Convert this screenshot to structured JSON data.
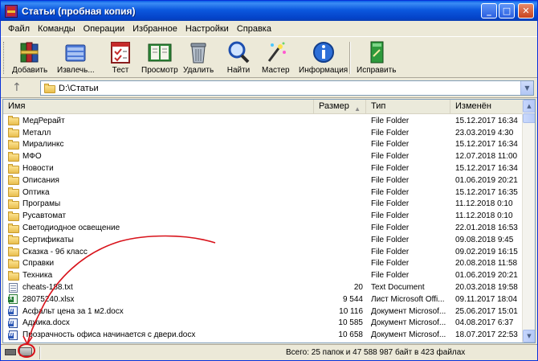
{
  "window": {
    "title": "Статьи (пробная копия)",
    "min_glyph": "_",
    "max_glyph": "□",
    "close_glyph": "✕"
  },
  "menu": [
    "Файл",
    "Команды",
    "Операции",
    "Избранное",
    "Настройки",
    "Справка"
  ],
  "toolbar": {
    "buttons": [
      {
        "label": "Добавить",
        "icon": "archive-books-icon"
      },
      {
        "label": "Извлечь...",
        "icon": "extract-folder-icon"
      },
      {
        "label": "Тест",
        "icon": "test-checklist-icon"
      },
      {
        "label": "Просмотр",
        "icon": "view-book-icon"
      },
      {
        "label": "Удалить",
        "icon": "trash-can-icon"
      },
      {
        "label": "Найти",
        "icon": "magnifier-icon"
      },
      {
        "label": "Мастер",
        "icon": "magic-wand-icon"
      },
      {
        "label": "Информация",
        "icon": "info-icon"
      },
      {
        "label": "Исправить",
        "icon": "repair-book-icon"
      }
    ]
  },
  "address": {
    "up_glyph": "↑",
    "path": "D:\\Статьи",
    "dropdown_glyph": "▼"
  },
  "columns": {
    "name": "Имя",
    "size": "Размер",
    "type": "Тип",
    "modified": "Изменён",
    "sort_glyph": "▲"
  },
  "files": [
    {
      "name": "МедРерайт",
      "size": "",
      "type": "File Folder",
      "modified": "15.12.2017 16:34",
      "kind": "folder"
    },
    {
      "name": "Металл",
      "size": "",
      "type": "File Folder",
      "modified": "23.03.2019 4:30",
      "kind": "folder"
    },
    {
      "name": "Миралинкс",
      "size": "",
      "type": "File Folder",
      "modified": "15.12.2017 16:34",
      "kind": "folder"
    },
    {
      "name": "МФО",
      "size": "",
      "type": "File Folder",
      "modified": "12.07.2018 11:00",
      "kind": "folder"
    },
    {
      "name": "Новости",
      "size": "",
      "type": "File Folder",
      "modified": "15.12.2017 16:34",
      "kind": "folder"
    },
    {
      "name": "Описания",
      "size": "",
      "type": "File Folder",
      "modified": "01.06.2019 20:21",
      "kind": "folder"
    },
    {
      "name": "Оптика",
      "size": "",
      "type": "File Folder",
      "modified": "15.12.2017 16:35",
      "kind": "folder"
    },
    {
      "name": "Програмы",
      "size": "",
      "type": "File Folder",
      "modified": "11.12.2018 0:10",
      "kind": "folder"
    },
    {
      "name": "Русавтомат",
      "size": "",
      "type": "File Folder",
      "modified": "11.12.2018 0:10",
      "kind": "folder"
    },
    {
      "name": "Светодиодное освещение",
      "size": "",
      "type": "File Folder",
      "modified": "22.01.2018 16:53",
      "kind": "folder"
    },
    {
      "name": "Сертификаты",
      "size": "",
      "type": "File Folder",
      "modified": "09.08.2018 9:45",
      "kind": "folder"
    },
    {
      "name": "Сказка - 9б класс",
      "size": "",
      "type": "File Folder",
      "modified": "09.02.2019 16:15",
      "kind": "folder"
    },
    {
      "name": "Справки",
      "size": "",
      "type": "File Folder",
      "modified": "20.08.2018 11:58",
      "kind": "folder"
    },
    {
      "name": "Техника",
      "size": "",
      "type": "File Folder",
      "modified": "01.06.2019 20:21",
      "kind": "folder"
    },
    {
      "name": "cheats-188.txt",
      "size": "20",
      "type": "Text Document",
      "modified": "20.03.2018 19:58",
      "kind": "txt"
    },
    {
      "name": "28075240.xlsx",
      "size": "9 544",
      "type": "Лист Microsoft Offi...",
      "modified": "09.11.2017 18:04",
      "kind": "xls"
    },
    {
      "name": "Асфальт цена за 1 м2.docx",
      "size": "10 116",
      "type": "Документ Microsof...",
      "modified": "25.06.2017 15:01",
      "kind": "doc"
    },
    {
      "name": "Аджика.docx",
      "size": "10 585",
      "type": "Документ Microsof...",
      "modified": "04.08.2017 6:37",
      "kind": "doc"
    },
    {
      "name": "Прозрачность офиса начинается с двери.docx",
      "size": "10 658",
      "type": "Документ Microsof...",
      "modified": "18.07.2017 22:53",
      "kind": "doc"
    }
  ],
  "scrollbar": {
    "up_glyph": "▲",
    "down_glyph": "▼"
  },
  "status": {
    "summary": "Всего: 25 папок и 47 588 987 байт в 423 файлах",
    "key_icon": "key-icon",
    "drive_icon": "drive-icon"
  },
  "colors": {
    "titlebar": "#0c58de",
    "annotation": "#d8121a"
  }
}
